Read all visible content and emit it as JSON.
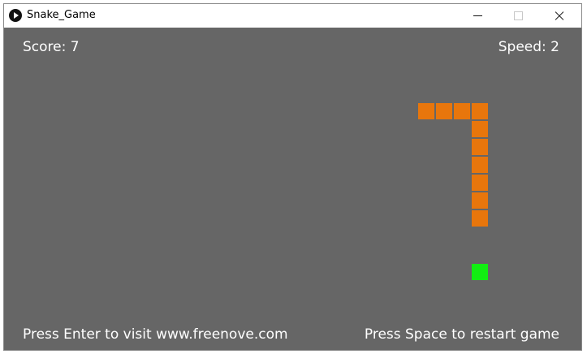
{
  "window": {
    "title": "Snake_Game",
    "icon": "play-circle-icon"
  },
  "hud": {
    "score_text": "Score: 7",
    "speed_text": "Speed: 2",
    "hint_left": "Press Enter to visit www.freenove.com",
    "hint_right": "Press Space to restart game"
  },
  "game": {
    "score": 7,
    "speed": 2,
    "snake_segments_count": 10,
    "background_color": "#666666",
    "snake_color": "#e8760c",
    "food_color": "#12ee12"
  }
}
